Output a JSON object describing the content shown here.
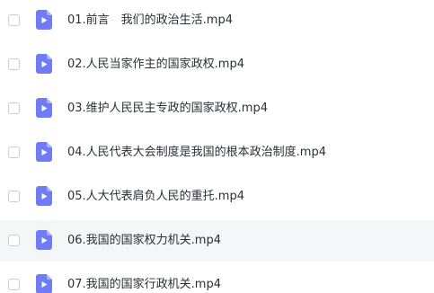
{
  "files": [
    {
      "name": "01.前言　我们的政治生活.mp4",
      "icon": "video-file-icon"
    },
    {
      "name": "02.人民当家作主的国家政权.mp4",
      "icon": "video-file-icon"
    },
    {
      "name": "03.维护人民民主专政的国家政权.mp4",
      "icon": "video-file-icon"
    },
    {
      "name": "04.人民代表大会制度是我国的根本政治制度.mp4",
      "icon": "video-file-icon"
    },
    {
      "name": "05.人大代表肩负人民的重托.mp4",
      "icon": "video-file-icon"
    },
    {
      "name": "06.我国的国家权力机关.mp4",
      "icon": "video-file-icon",
      "hovered": true
    },
    {
      "name": "07.我国的国家行政机关.mp4",
      "icon": "video-file-icon"
    }
  ],
  "colors": {
    "icon_fill": "#6f7cf6",
    "hover_background": "#f5f6f8",
    "text": "#2b2f36"
  }
}
